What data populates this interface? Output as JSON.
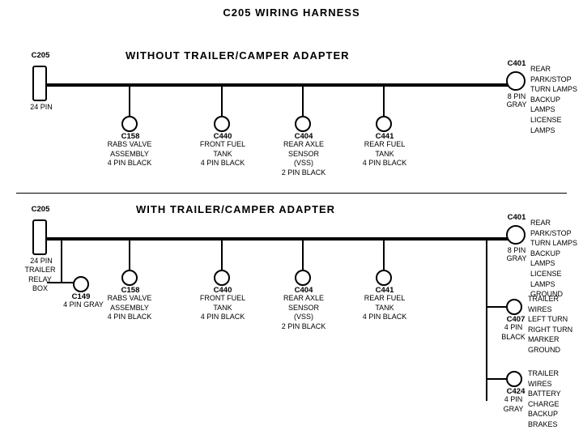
{
  "title": "C205 WIRING HARNESS",
  "section1_label": "WITHOUT  TRAILER/CAMPER  ADAPTER",
  "section2_label": "WITH  TRAILER/CAMPER  ADAPTER",
  "top": {
    "left_connector": {
      "id": "C205",
      "pins": "24 PIN"
    },
    "right_connector": {
      "id": "C401",
      "pins": "8 PIN",
      "color": "GRAY"
    },
    "right_label": "REAR PARK/STOP\nTURN LAMPS\nBACKUP LAMPS\nLICENSE LAMPS",
    "connectors": [
      {
        "id": "C158",
        "desc": "RABS VALVE\nASSEMBLY\n4 PIN BLACK"
      },
      {
        "id": "C440",
        "desc": "FRONT FUEL\nTANK\n4 PIN BLACK"
      },
      {
        "id": "C404",
        "desc": "REAR AXLE\nSENSOR\n(VSS)\n2 PIN BLACK"
      },
      {
        "id": "C441",
        "desc": "REAR FUEL\nTANK\n4 PIN BLACK"
      }
    ]
  },
  "bottom": {
    "left_connector": {
      "id": "C205",
      "pins": "24 PIN"
    },
    "right_connector": {
      "id": "C401",
      "pins": "8 PIN",
      "color": "GRAY"
    },
    "right_label": "REAR PARK/STOP\nTURN LAMPS\nBACKUP LAMPS\nLICENSE LAMPS\nGROUND",
    "trailer_relay": "TRAILER\nRELAY\nBOX",
    "c149": {
      "id": "C149",
      "desc": "4 PIN GRAY"
    },
    "connectors": [
      {
        "id": "C158",
        "desc": "RABS VALVE\nASSEMBLY\n4 PIN BLACK"
      },
      {
        "id": "C440",
        "desc": "FRONT FUEL\nTANK\n4 PIN BLACK"
      },
      {
        "id": "C404",
        "desc": "REAR AXLE\nSENSOR\n(VSS)\n2 PIN BLACK"
      },
      {
        "id": "C441",
        "desc": "REAR FUEL\nTANK\n4 PIN BLACK"
      }
    ],
    "right_connectors": [
      {
        "id": "C407",
        "desc": "4 PIN\nBLACK",
        "label": "TRAILER WIRES\nLEFT TURN\nRIGHT TURN\nMARKER\nGROUND"
      },
      {
        "id": "C424",
        "desc": "4 PIN\nGRAY",
        "label": "TRAILER WIRES\nBATTERY CHARGE\nBACKUP\nBRAKES"
      }
    ]
  }
}
